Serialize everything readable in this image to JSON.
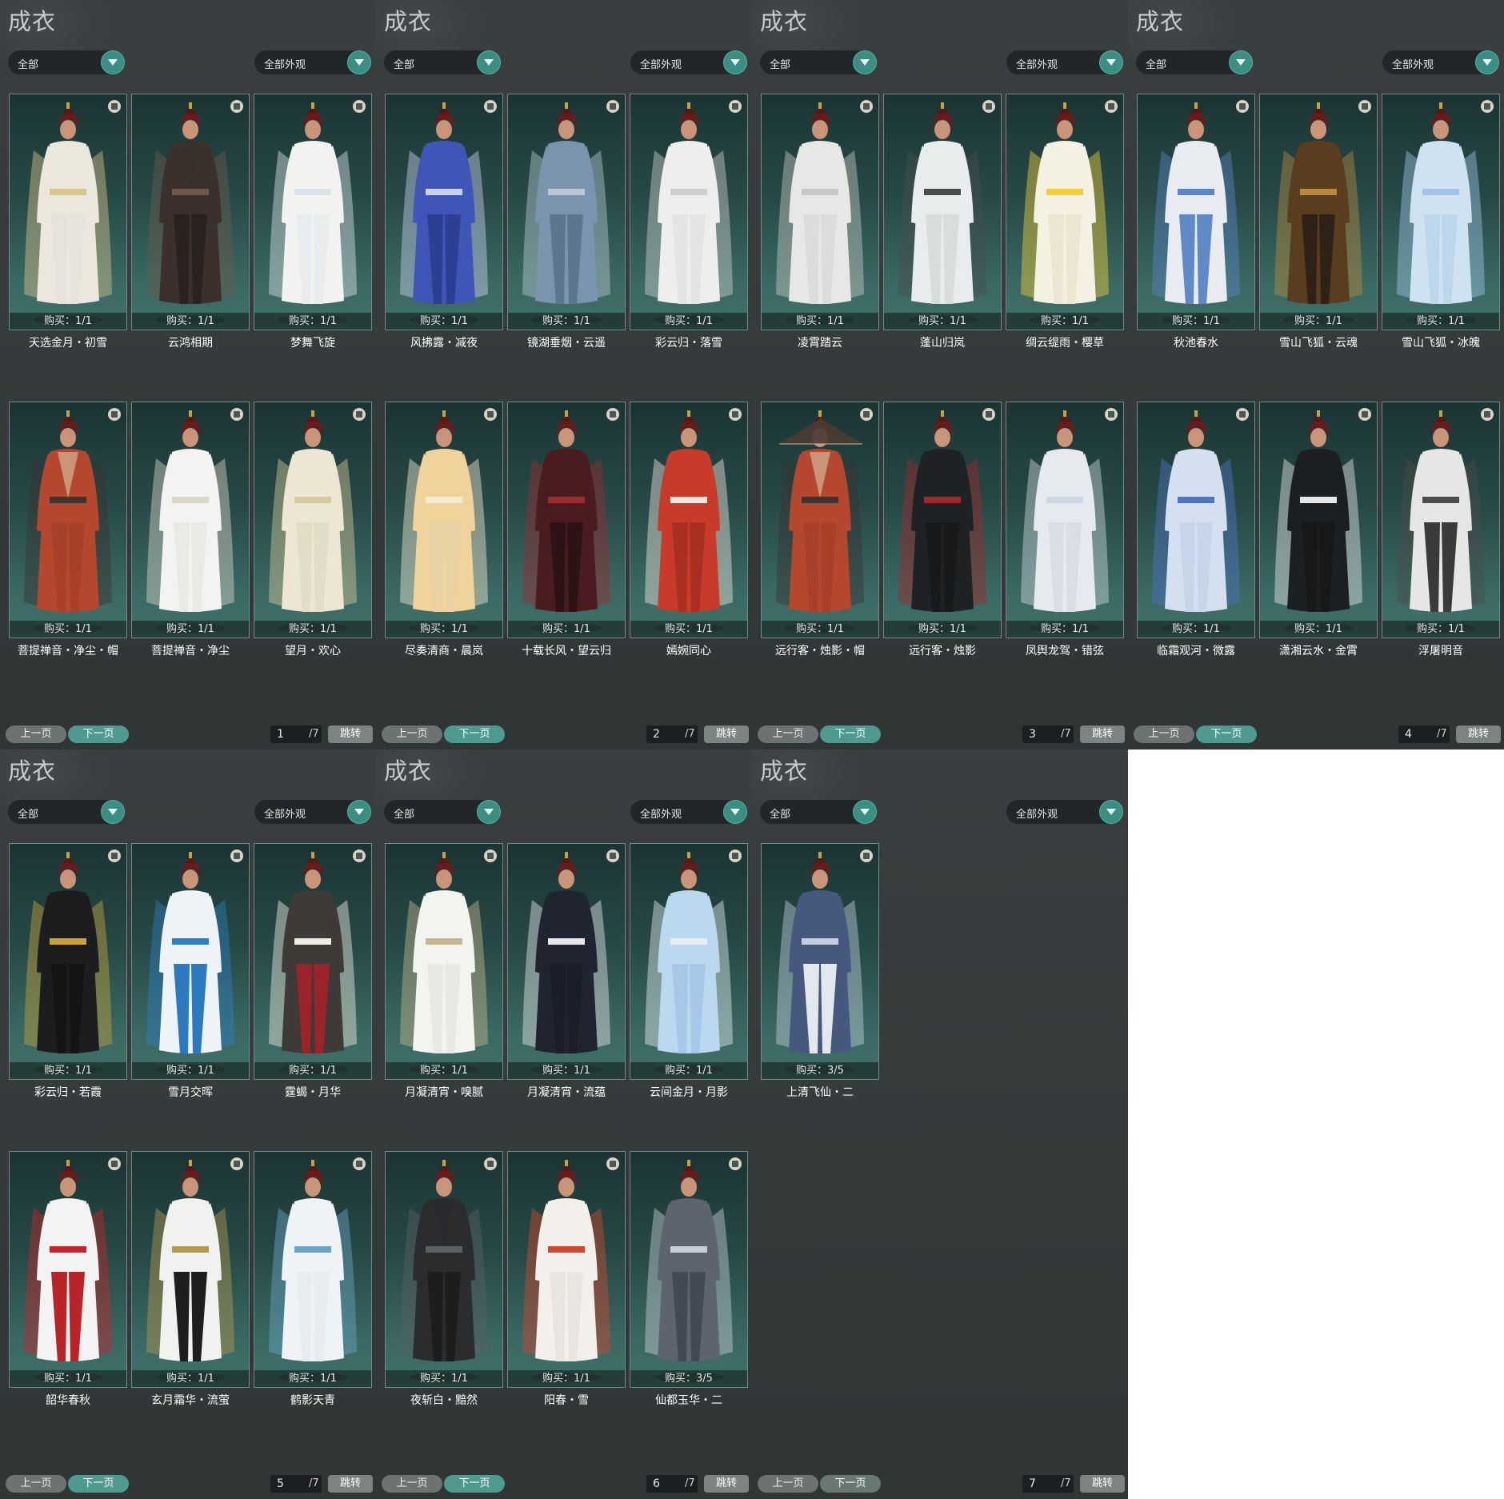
{
  "palette": {
    "panel_bg": "#363b3c",
    "accent": "#4f9a8f",
    "card_border": "#6f8b86",
    "card_top": "#1b3433",
    "card_bottom": "#41726b"
  },
  "panels": [
    {
      "title": "成衣",
      "filter_left": "全部",
      "filter_right": "全部外观",
      "prev_label": "上一页",
      "next_label": "下一页",
      "page": "1",
      "total": "/7",
      "jump_label": "跳转",
      "cards": [
        {
          "name": "天选金月・初雪",
          "buy": "购买：1/1",
          "robe": "#ece7dc",
          "trim": "#d7c58f",
          "pants": "#e8e3da"
        },
        {
          "name": "云鸿相期",
          "buy": "购买：1/1",
          "robe": "#3b302c",
          "trim": "#6d5a4c",
          "pants": "#2a2220"
        },
        {
          "name": "梦舞飞旋",
          "buy": "购买：1/1",
          "robe": "#f2f2f0",
          "trim": "#d9e2e6",
          "pants": "#e8ecee"
        },
        {
          "name": "风拂露・减夜",
          "buy": "购买：1/1",
          "robe": "#3f56b8",
          "trim": "#c7d1f0",
          "pants": "#2c3f92"
        },
        {
          "name": "镜湖垂烟・云遥",
          "buy": "购买：1/1",
          "robe": "#7a94ad",
          "trim": "#b8c8d6",
          "pants": "#5d7690"
        },
        {
          "name": "彩云归・落雪",
          "buy": "购买：1/1",
          "robe": "#eeeeee",
          "trim": "#cfcfcf",
          "pants": "#e4e4e4"
        }
      ],
      "cards2": [
        {
          "name": "菩提禅音・净尘・帽",
          "buy": "购买：1/1",
          "robe": "#b5472f",
          "trim": "#3a3432",
          "pants": "#a8402b",
          "bare": true
        },
        {
          "name": "菩提禅音・净尘",
          "buy": "购买：1/1",
          "robe": "#f3f3f1",
          "trim": "#d9d6c8",
          "pants": "#e9e9e6"
        },
        {
          "name": "望月・欢心",
          "buy": "购买：1/1",
          "robe": "#ece6d2",
          "trim": "#d6c99e",
          "pants": "#e3dcc6"
        },
        {
          "name": "尽奏清商・晨岚",
          "buy": "购买：1/1",
          "robe": "#efd39a",
          "trim": "#f4ead2",
          "pants": "#e9d2a6"
        },
        {
          "name": "十载长风・望云归",
          "buy": "购买：1/1",
          "robe": "#4a1c20",
          "trim": "#9c2a2e",
          "pants": "#2c1416"
        },
        {
          "name": "嫣婉同心",
          "buy": "购买：1/1",
          "robe": "#c83a2a",
          "trim": "#f1e6e0",
          "pants": "#a92f22"
        }
      ]
    },
    {
      "title": "成衣",
      "filter_left": "全部",
      "filter_right": "全部外观",
      "prev_label": "上一页",
      "next_label": "下一页",
      "page": "2",
      "total": "/7",
      "jump_label": "跳转",
      "cards": [
        {
          "name": "凌霄踏云",
          "buy": "购买：1/1",
          "robe": "#e7e7e5",
          "trim": "#c8c8c4",
          "pants": "#dcdcda"
        },
        {
          "name": "蓬山归岚",
          "buy": "购买：1/1",
          "robe": "#e9ecec",
          "trim": "#4a4d50",
          "pants": "#d8dcdc"
        },
        {
          "name": "绸云缇雨・樱草",
          "buy": "购买：1/1",
          "robe": "#f4f1e3",
          "trim": "#f2cf3a",
          "pants": "#ebe6d2"
        },
        {
          "name": "秋池春水",
          "buy": "购买：1/1",
          "robe": "#e8ebef",
          "trim": "#5a86c4",
          "pants": "#5f8ac7"
        },
        {
          "name": "雪山飞狐・云魂",
          "buy": "购买：1/1",
          "robe": "#5a3d1e",
          "trim": "#b78a3e",
          "pants": "#2e2217"
        },
        {
          "name": "雪山飞狐・冰魄",
          "buy": "购买：1/1",
          "robe": "#cfe2f2",
          "trim": "#9ec3e6",
          "pants": "#bcd6ec"
        }
      ],
      "cards2": [
        {
          "name": "远行客・烛影・帽",
          "buy": "购买：1/1",
          "robe": "#b5472f",
          "trim": "#3a3432",
          "pants": "#a8402b",
          "bare": true,
          "hat": true
        },
        {
          "name": "远行客・烛影",
          "buy": "购买：1/1",
          "robe": "#1f2224",
          "trim": "#a1282a",
          "pants": "#17191a"
        },
        {
          "name": "凤舆龙驾・错弦",
          "buy": "购买：1/1",
          "robe": "#e6eaef",
          "trim": "#cfd8e2",
          "pants": "#d9dee6"
        },
        {
          "name": "临霜观河・微露",
          "buy": "购买：1/1",
          "robe": "#d4e0f0",
          "trim": "#4f74c2",
          "pants": "#c6d5ea"
        },
        {
          "name": "潇湘云水・金霄",
          "buy": "购买：1/1",
          "robe": "#1c1f21",
          "trim": "#e8e8e8",
          "pants": "#161819"
        },
        {
          "name": "浮屠明音",
          "buy": "购买：1/1",
          "robe": "#e6e6e6",
          "trim": "#4c4c4c",
          "pants": "#3a3a3a"
        }
      ]
    },
    {
      "title": "成衣",
      "filter_left": "全部",
      "filter_right": "全部外观",
      "prev_label": "上一页",
      "next_label": "下一页",
      "page": "3",
      "total": "/7",
      "jump_label": "跳转",
      "cards": [
        {
          "name": "彩云归・若霞",
          "buy": "购买：1/1",
          "robe": "#1d1d1f",
          "trim": "#c9a23c",
          "pants": "#141416"
        },
        {
          "name": "雪月交晖",
          "buy": "购买：1/1",
          "robe": "#eef3f6",
          "trim": "#2f7fc4",
          "pants": "#2b79be"
        },
        {
          "name": "霆蝎・月华",
          "buy": "购买：1/1",
          "robe": "#3d3a37",
          "trim": "#f1ede4",
          "pants": "#9b2329"
        },
        {
          "name": "月凝清宵・嗅腻",
          "buy": "购买：1/1",
          "robe": "#f3f3f0",
          "trim": "#c6b98f",
          "pants": "#e8e8e4"
        },
        {
          "name": "月凝清宵・流蕴",
          "buy": "购买：1/1",
          "robe": "#1f2430",
          "trim": "#e8e8e8",
          "pants": "#1a1e28"
        },
        {
          "name": "云间金月・月影",
          "buy": "购买：1/1",
          "robe": "#bcd8ef",
          "trim": "#e6eef5",
          "pants": "#a6c8e6"
        }
      ],
      "cards2": [
        {
          "name": "韶华春秋",
          "buy": "购买：1/1",
          "robe": "#f3f3f3",
          "trim": "#c8252a",
          "pants": "#b92429"
        },
        {
          "name": "玄月霜华・流萤",
          "buy": "购买：1/1",
          "robe": "#f1f1ef",
          "trim": "#b59a52",
          "pants": "#1e1e1e"
        },
        {
          "name": "鹤影天青",
          "buy": "购买：1/1",
          "robe": "#f0f3f5",
          "trim": "#6aa6c6",
          "pants": "#e6ecef"
        },
        {
          "name": "夜斩白・黯然",
          "buy": "购买：1/1",
          "robe": "#2a2c2e",
          "trim": "#5c6064",
          "pants": "#1c1d1f"
        },
        {
          "name": "阳春・雪",
          "buy": "购买：1/1",
          "robe": "#f3efea",
          "trim": "#d3462e",
          "pants": "#e9e4de"
        },
        {
          "name": "仙都玉华・二",
          "buy": "购买：3/5",
          "robe": "#5c6470",
          "trim": "#c9ced6",
          "pants": "#434a55"
        }
      ]
    },
    {
      "title": "成衣",
      "filter_left": "全部",
      "filter_right": "全部外观",
      "prev_label": "上一页",
      "next_label": "下一页",
      "page": "4",
      "total": "/7",
      "jump_label": "跳转",
      "cards": [],
      "cards2": []
    },
    {
      "title": "成衣",
      "filter_left": "全部",
      "filter_right": "全部外观",
      "prev_label": "上一页",
      "next_label": "下一页",
      "page": "5",
      "total": "/7",
      "jump_label": "跳转",
      "cards": [],
      "cards2": []
    },
    {
      "title": "成衣",
      "filter_left": "全部",
      "filter_right": "全部外观",
      "prev_label": "上一页",
      "next_label": "下一页",
      "page": "6",
      "total": "/7",
      "jump_label": "跳转",
      "cards": [],
      "cards2": []
    },
    {
      "title": "成衣",
      "filter_left": "全部",
      "filter_right": "全部外观",
      "prev_label": "上一页",
      "next_label": "下一页",
      "page": "7",
      "total": "/7",
      "jump_label": "跳转",
      "cards": [
        {
          "name": "上清飞仙・二",
          "buy": "购买：3/5",
          "robe": "#46587e",
          "trim": "#c3cede",
          "pants": "#e3e7ee"
        }
      ],
      "cards2": []
    }
  ]
}
